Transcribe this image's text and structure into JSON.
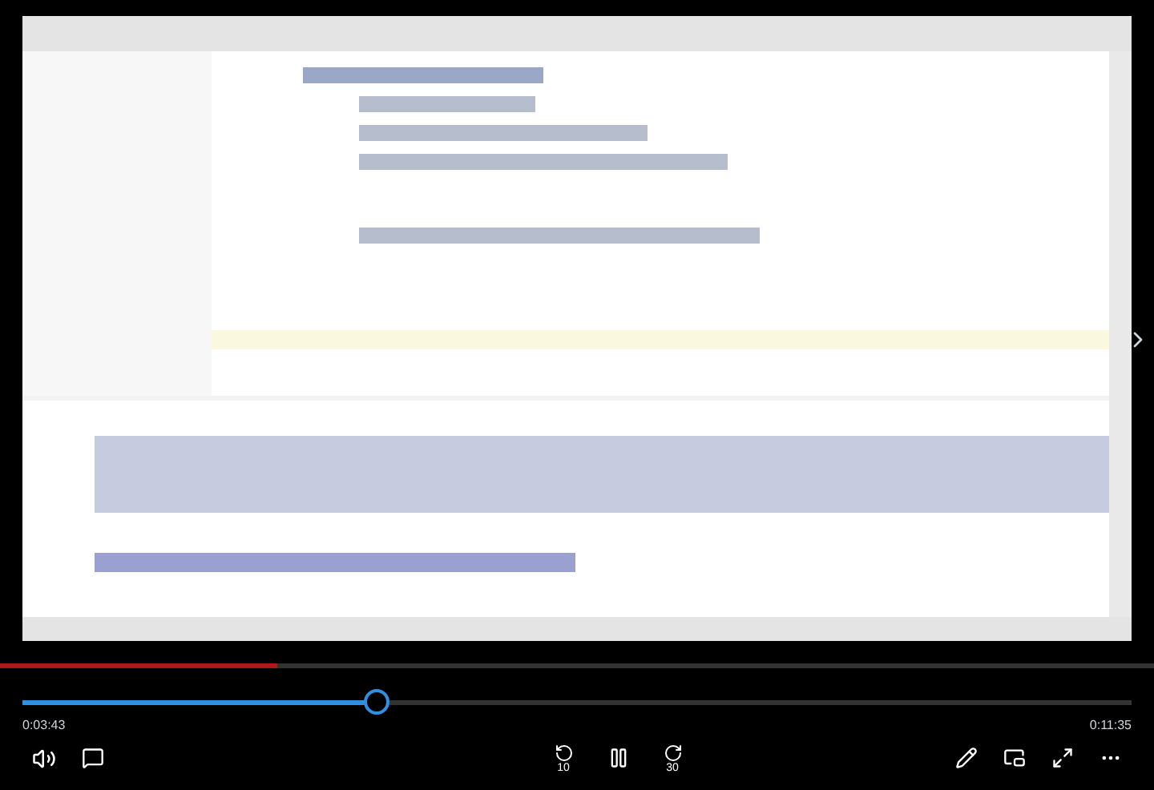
{
  "loading_bar": {
    "level": 0.24
  },
  "seek": {
    "level": 0.32,
    "elapsed": "0:03:43",
    "total": "0:11:35"
  },
  "controls": {
    "rewind_seconds": "10",
    "forward_seconds": "30"
  }
}
